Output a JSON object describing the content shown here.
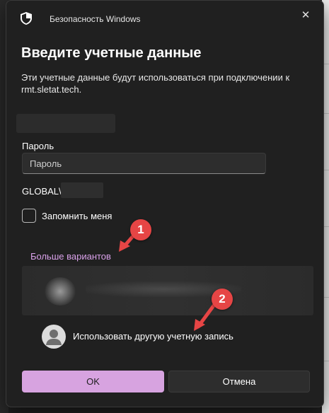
{
  "window": {
    "app_title": "Безопасность Windows",
    "close_glyph": "✕"
  },
  "dialog": {
    "heading": "Введите учетные данные",
    "description": "Эти учетные данные будут использоваться при подключении к rmt.sletat.tech.",
    "password_label": "Пароль",
    "password_placeholder": "Пароль",
    "domain_prefix": "GLOBAL\\",
    "remember_label": "Запомнить меня",
    "remember_checked": false,
    "more_options": "Больше вариантов",
    "other_account": "Использовать другую учетную запись",
    "ok_label": "OK",
    "cancel_label": "Отмена"
  },
  "annotations": [
    {
      "number": "1"
    },
    {
      "number": "2"
    }
  ],
  "colors": {
    "accent": "#d7a3e0",
    "link": "#d8a0e8",
    "annotation": "#e64545",
    "dialog_bg": "#202020"
  },
  "icons": {
    "title": "shield-icon",
    "close": "close-icon",
    "avatar": "person-icon"
  }
}
